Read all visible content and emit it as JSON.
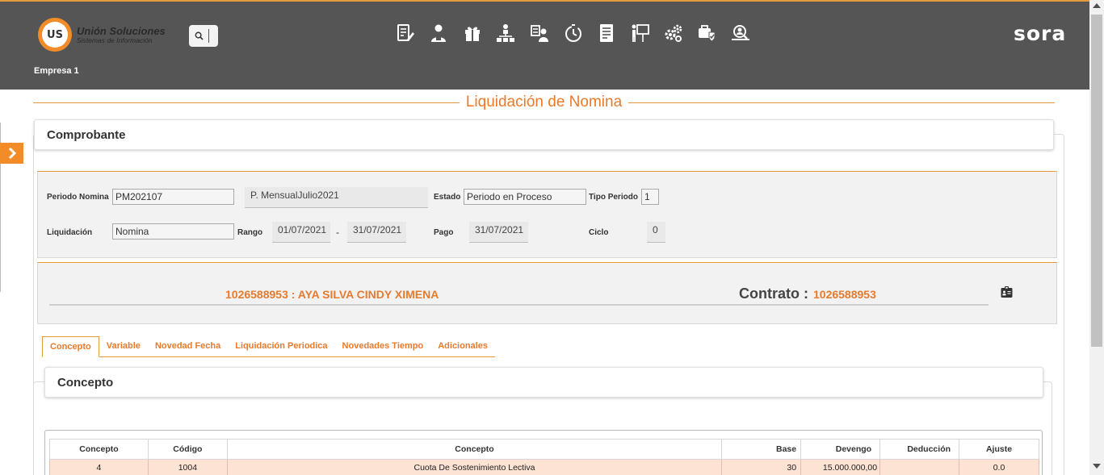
{
  "header": {
    "logo_mark": "US",
    "logo_title": "Unión Soluciones",
    "logo_subtitle": "Sistemas de Información",
    "brand": "sora",
    "company": "Empresa 1",
    "accent": "#e39a3b",
    "toolbar_icons": [
      "edit-document-icon",
      "employee-icon",
      "gift-icon",
      "org-chart-icon",
      "user-card-icon",
      "timer-icon",
      "report-icon",
      "presentation-icon",
      "settings-gears-icon",
      "shield-check-icon",
      "user-search-icon"
    ]
  },
  "page": {
    "title": "Liquidación de Nomina",
    "card_title": "Comprobante"
  },
  "form": {
    "periodo_label": "Periodo Nomina",
    "periodo_value": "PM202107",
    "periodo_desc": "P. MensualJulio2021",
    "estado_label": "Estado",
    "estado_value": "Periodo en Proceso",
    "tipo_label": "Tipo Periodo",
    "tipo_value": "1",
    "liquidacion_label": "Liquidación",
    "liquidacion_value": "Nomina",
    "rango_label": "Rango",
    "rango_from": "01/07/2021",
    "rango_sep": "-",
    "rango_to": "31/07/2021",
    "pago_label": "Pago",
    "pago_value": "31/07/2021",
    "ciclo_label": "Ciclo",
    "ciclo_value": "0"
  },
  "employee": {
    "name": "1026588953 : AYA SILVA CINDY XIMENA",
    "contrato_label": "Contrato :",
    "contrato_value": "1026588953"
  },
  "tabs": [
    "Concepto",
    "Variable",
    "Novedad Fecha",
    "Liquidación Periodica",
    "Novedades Tiempo",
    "Adicionales"
  ],
  "concept_panel": {
    "title": "Concepto",
    "columns": [
      "Concepto",
      "Código",
      "Concepto",
      "Base",
      "Devengo",
      "Deducción",
      "Ajuste"
    ],
    "rows": [
      [
        "4",
        "1004",
        "Cuota De Sostenimiento Lectiva",
        "30",
        "15.000.000,00",
        "",
        "0.0"
      ]
    ]
  }
}
